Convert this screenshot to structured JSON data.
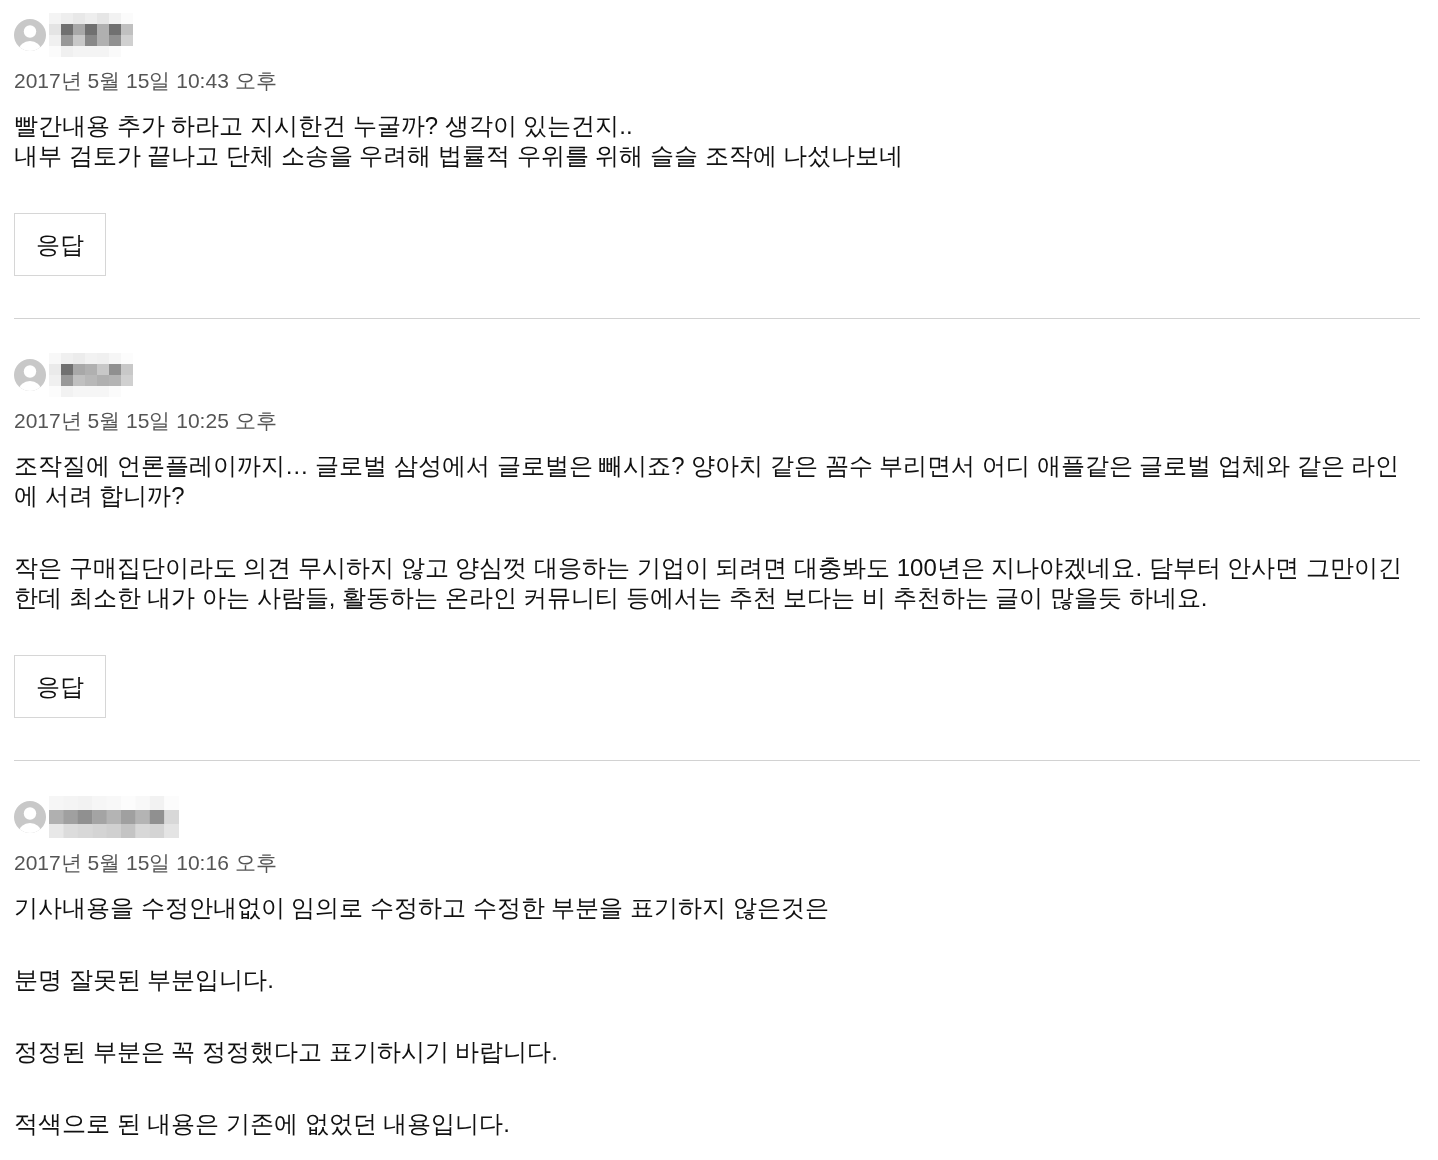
{
  "comments": [
    {
      "date": "2017년 5월 15일 10:43 오후",
      "paragraphs": [
        "빨간내용 추가 하라고 지시한건 누굴까? 생각이 있는건지..\n내부 검토가 끝나고 단체 소송을 우려해 법률적 우위를 위해 슬슬 조작에 나섰나보네"
      ],
      "reply_label": "응답"
    },
    {
      "date": "2017년 5월 15일 10:25 오후",
      "paragraphs": [
        "조작질에 언론플레이까지… 글로벌 삼성에서 글로벌은 빼시죠? 양아치 같은 꼼수 부리면서 어디 애플같은 글로벌 업체와 같은 라인에 서려 합니까?",
        "작은 구매집단이라도 의견 무시하지 않고 양심껏 대응하는 기업이 되려면 대충봐도 100년은 지나야겠네요. 담부터 안사면 그만이긴 한데 최소한 내가 아는 사람들, 활동하는 온라인 커뮤니티 등에서는 추천 보다는 비 추천하는 글이 많을듯 하네요."
      ],
      "reply_label": "응답"
    },
    {
      "date": "2017년 5월 15일 10:16 오후",
      "paragraphs": [
        "기사내용을 수정안내없이 임의로 수정하고 수정한 부분을 표기하지 않은것은",
        "분명 잘못된 부분입니다.",
        "정정된 부분은 꼭 정정했다고 표기하시기 바랍니다.",
        "적색으로 된 내용은 기존에 없었던 내용입니다."
      ]
    }
  ]
}
